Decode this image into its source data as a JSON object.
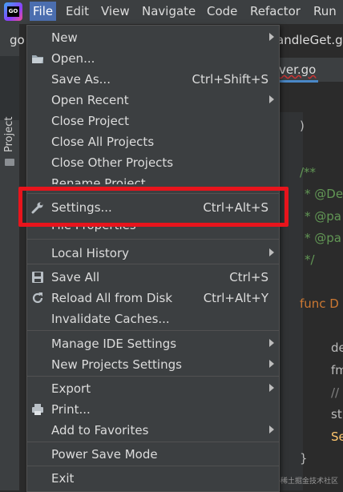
{
  "menubar": {
    "logo_text": "GO",
    "items": [
      {
        "label": "File"
      },
      {
        "label": "Edit"
      },
      {
        "label": "View"
      },
      {
        "label": "Navigate"
      },
      {
        "label": "Code"
      },
      {
        "label": "Refactor"
      },
      {
        "label": "Run"
      }
    ]
  },
  "background": {
    "title_fragment": "go",
    "handler_fragment": "andleGet.go",
    "tab_fragment": "ver.go",
    "tool_window": "Project",
    "code_lines": [
      ")",
      "/**",
      "* @De",
      "* @pa",
      "* @pa",
      "*/",
      "func D",
      "de",
      "fm",
      "//",
      "st",
      "Se",
      "}"
    ],
    "watermark": "@稀土掘金技术社区"
  },
  "file_menu": {
    "items": [
      {
        "label": "New",
        "shortcut": "",
        "submenu": true,
        "icon": ""
      },
      {
        "label": "Open...",
        "shortcut": "",
        "submenu": false,
        "icon": "folder-icon"
      },
      {
        "label": "Save As...",
        "shortcut": "Ctrl+Shift+S",
        "submenu": false,
        "icon": ""
      },
      {
        "label": "Open Recent",
        "shortcut": "",
        "submenu": true,
        "icon": ""
      },
      {
        "label": "Close Project",
        "shortcut": "",
        "submenu": false,
        "icon": ""
      },
      {
        "label": "Close All Projects",
        "shortcut": "",
        "submenu": false,
        "icon": ""
      },
      {
        "label": "Close Other Projects",
        "shortcut": "",
        "submenu": false,
        "icon": ""
      },
      {
        "label": "Rename Project...",
        "shortcut": "",
        "submenu": false,
        "icon": ""
      },
      {
        "label": "Settings...",
        "shortcut": "Ctrl+Alt+S",
        "submenu": false,
        "icon": "wrench-icon"
      },
      {
        "label": "File Properties",
        "shortcut": "",
        "submenu": true,
        "icon": ""
      },
      {
        "label": "Local History",
        "shortcut": "",
        "submenu": true,
        "icon": ""
      },
      {
        "label": "Save All",
        "shortcut": "Ctrl+S",
        "submenu": false,
        "icon": "save-icon"
      },
      {
        "label": "Reload All from Disk",
        "shortcut": "Ctrl+Alt+Y",
        "submenu": false,
        "icon": "reload-icon"
      },
      {
        "label": "Invalidate Caches...",
        "shortcut": "",
        "submenu": false,
        "icon": ""
      },
      {
        "label": "Manage IDE Settings",
        "shortcut": "",
        "submenu": true,
        "icon": ""
      },
      {
        "label": "New Projects Settings",
        "shortcut": "",
        "submenu": true,
        "icon": ""
      },
      {
        "label": "Export",
        "shortcut": "",
        "submenu": true,
        "icon": ""
      },
      {
        "label": "Print...",
        "shortcut": "",
        "submenu": false,
        "icon": "print-icon"
      },
      {
        "label": "Add to Favorites",
        "shortcut": "",
        "submenu": true,
        "icon": ""
      },
      {
        "label": "Power Save Mode",
        "shortcut": "",
        "submenu": false,
        "icon": ""
      },
      {
        "label": "Exit",
        "shortcut": "",
        "submenu": false,
        "icon": ""
      }
    ]
  },
  "colors": {
    "menu_bg": "#3c3f41",
    "active_menu": "#4b6eaf",
    "highlight_border": "#e8141c",
    "keyword": "#cc7832",
    "comment": "#629755"
  }
}
